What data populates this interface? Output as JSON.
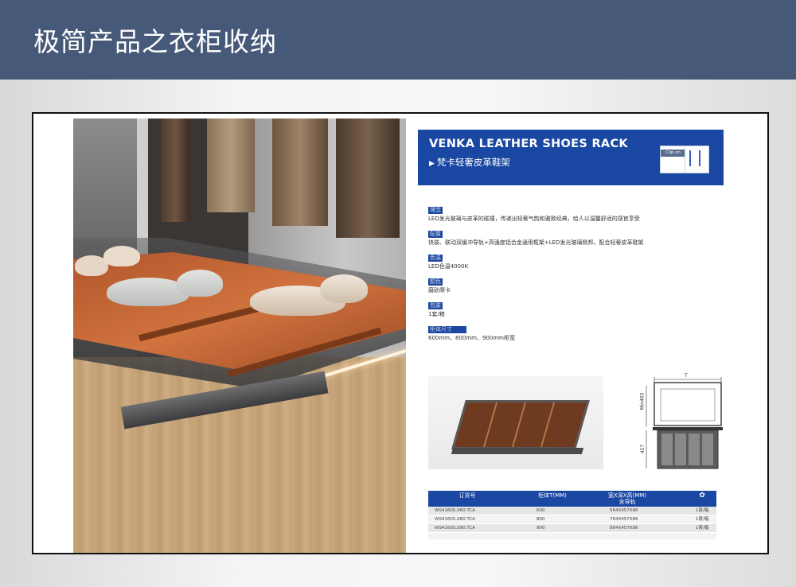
{
  "header": {
    "title": "极简产品之衣柜收纳"
  },
  "product": {
    "title_en": "VENKA LEATHER SHOES RACK",
    "title_cn": "梵卡轻奢皮革鞋架",
    "badge_clip": "Clip on",
    "triangle_glyph": "▶"
  },
  "specs": [
    {
      "label": "理念",
      "text": "LED发光玻璃与皮革的碰撞，传递出轻奢气韵和雅致经典，给人以温馨舒适的感官享受"
    },
    {
      "label": "配置",
      "text": "快装、联动双缓冲导轨+高强度铝合金通用框架+LED发光玻璃侧邦，配合轻奢皮革鞋架"
    },
    {
      "label": "色温",
      "text": "LED色温4000K"
    },
    {
      "label": "颜色",
      "text": "磨砂摩卡"
    },
    {
      "label": "包装",
      "text": "1套/箱"
    },
    {
      "label": "柜体尺寸",
      "text": "600mm、800mm、900mm柜宽"
    }
  ],
  "drawing": {
    "top_dim": "T",
    "side_dim": "Min465",
    "bottom_dim": "457"
  },
  "table": {
    "headers": [
      "订货号",
      "柜体T(MM)",
      "宽X深X高(MM)",
      "含导轨",
      "packaging-icon"
    ],
    "rows": [
      [
        "WS4160S.060.TCA",
        "600",
        "564X457X86",
        "1套/箱"
      ],
      [
        "WS4160S.080.TCA",
        "800",
        "764X457X86",
        "1套/箱"
      ],
      [
        "WS4160S.090.TCA",
        "900",
        "864X457X86",
        "1套/箱"
      ]
    ]
  },
  "colors": {
    "header_bg": "#475978",
    "brand_blue": "#1a47a2"
  }
}
